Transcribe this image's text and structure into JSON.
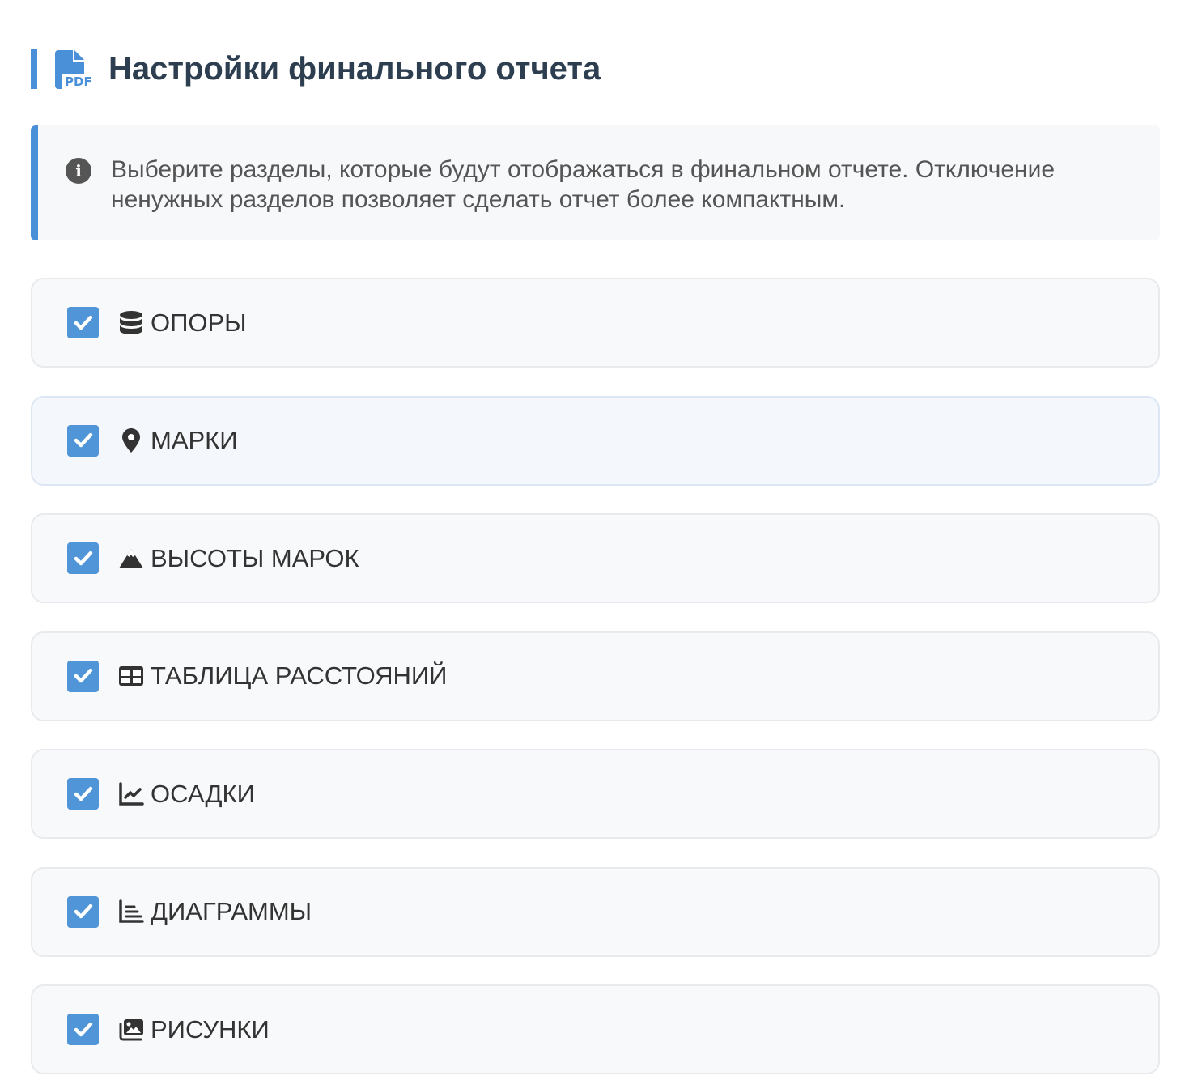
{
  "header": {
    "title": "Настройки финального отчета",
    "icon": "file-pdf-icon"
  },
  "info": {
    "text": "Выберите разделы, которые будут отображаться в финальном отчете. Отключение ненужных разделов позволяет сделать отчет более компактным.",
    "icon": "info-circle-icon"
  },
  "sections": [
    {
      "label": "ОПОРЫ",
      "icon": "database-icon",
      "checked": true
    },
    {
      "label": "МАРКИ",
      "icon": "map-marker-icon",
      "checked": true
    },
    {
      "label": "ВЫСОТЫ МАРОК",
      "icon": "mountain-icon",
      "checked": true
    },
    {
      "label": "ТАБЛИЦА РАССТОЯНИЙ",
      "icon": "table-icon",
      "checked": true
    },
    {
      "label": "ОСАДКИ",
      "icon": "chart-line-icon",
      "checked": true
    },
    {
      "label": "ДИАГРАММЫ",
      "icon": "chart-bar-icon",
      "checked": true
    },
    {
      "label": "РИСУНКИ",
      "icon": "images-icon",
      "checked": true
    }
  ],
  "colors": {
    "accent": "#4a90d9",
    "checkbox": "#4f95d8"
  }
}
